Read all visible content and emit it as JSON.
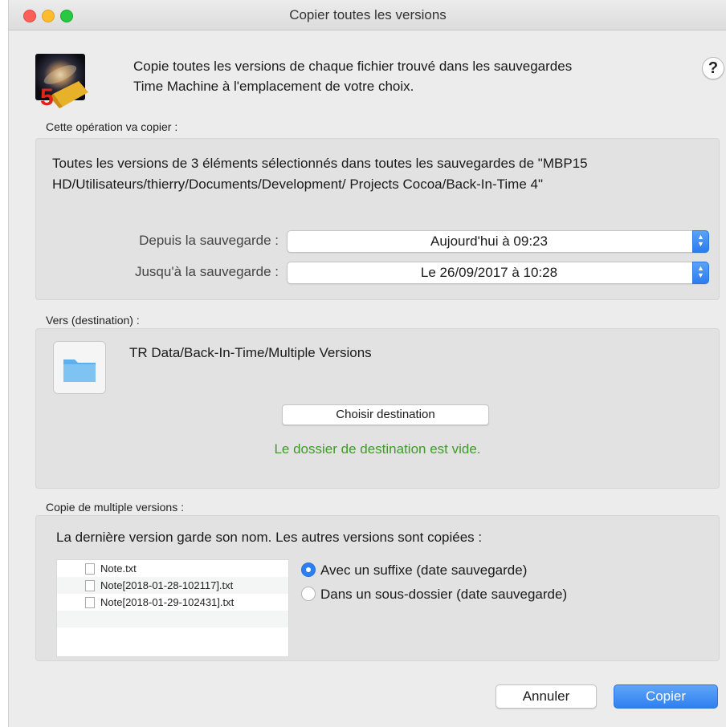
{
  "window": {
    "title": "Copier toutes les versions"
  },
  "header": {
    "intro_line1": "Copie toutes les versions de chaque fichier trouvé dans les sauvegardes",
    "intro_line2": "Time Machine à l'emplacement de votre choix.",
    "help_label": "?",
    "app_icon_badge": "5"
  },
  "operation": {
    "section_label": "Cette opération va copier :",
    "description_line1": "Toutes les versions de 3 éléments sélectionnés dans toutes les sauvegardes de \"MBP15",
    "description_line2": "HD/Utilisateurs/thierry/Documents/Development/ Projects Cocoa/Back-In-Time 4\"",
    "from_label": "Depuis la sauvegarde :",
    "from_value": "Aujourd'hui à 09:23",
    "to_label": "Jusqu'à la sauvegarde :",
    "to_value": "Le 26/09/2017 à 10:28"
  },
  "destination": {
    "section_label": "Vers (destination) :",
    "path": "TR Data/Back-In-Time/Multiple Versions",
    "choose_button": "Choisir destination",
    "status": "Le dossier de destination est vide."
  },
  "multiple": {
    "section_label": "Copie de multiple versions :",
    "description": "La dernière version garde son nom. Les autres versions sont copiées :",
    "files": [
      "Note.txt",
      "Note[2018-01-28-102117].txt",
      "Note[2018-01-29-102431].txt"
    ],
    "option_suffix": "Avec un suffixe (date sauvegarde)",
    "option_subfolder": "Dans un sous-dossier (date sauvegarde)"
  },
  "footer": {
    "cancel_button": "Annuler",
    "copy_button": "Copier"
  },
  "colors": {
    "accent": "#2d7ff1",
    "status_green": "#3f9a2b"
  }
}
